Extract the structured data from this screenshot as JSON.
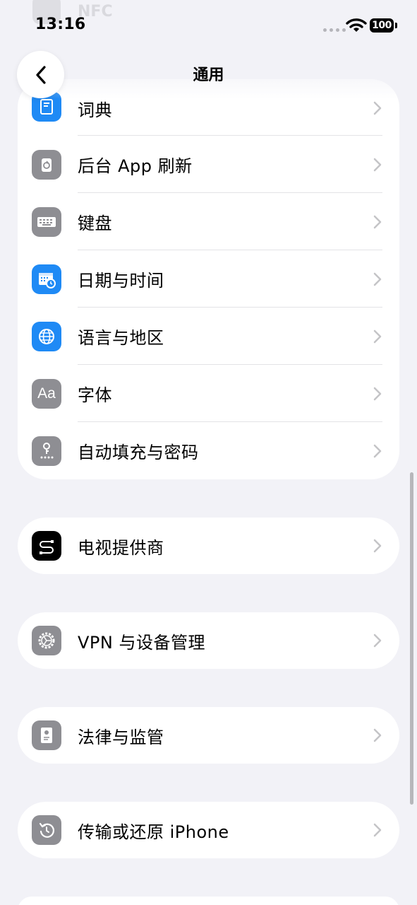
{
  "status_bar": {
    "time": "13:16",
    "battery": "100",
    "ghost_text": "NFC"
  },
  "nav": {
    "title": "通用"
  },
  "groups": [
    {
      "items": [
        {
          "label": "词典",
          "icon": "dictionary-icon",
          "color": "#1f8af5"
        },
        {
          "label": "后台 App 刷新",
          "icon": "background-refresh-icon",
          "color": "#8e8e93"
        },
        {
          "label": "键盘",
          "icon": "keyboard-icon",
          "color": "#8e8e93"
        },
        {
          "label": "日期与时间",
          "icon": "calendar-clock-icon",
          "color": "#1f8af5"
        },
        {
          "label": "语言与地区",
          "icon": "globe-icon",
          "color": "#1f8af5"
        },
        {
          "label": "字体",
          "icon": "font-icon",
          "color": "#8e8e93"
        },
        {
          "label": "自动填充与密码",
          "icon": "key-icon",
          "color": "#8e8e93"
        }
      ]
    },
    {
      "items": [
        {
          "label": "电视提供商",
          "icon": "tv-provider-icon",
          "color": "#000000"
        }
      ]
    },
    {
      "items": [
        {
          "label": "VPN 与设备管理",
          "icon": "gear-icon",
          "color": "#8e8e93"
        }
      ]
    },
    {
      "items": [
        {
          "label": "法律与监管",
          "icon": "legal-document-icon",
          "color": "#8e8e93"
        }
      ]
    },
    {
      "items": [
        {
          "label": "传输或还原 iPhone",
          "icon": "restore-icon",
          "color": "#8e8e93"
        }
      ]
    }
  ]
}
